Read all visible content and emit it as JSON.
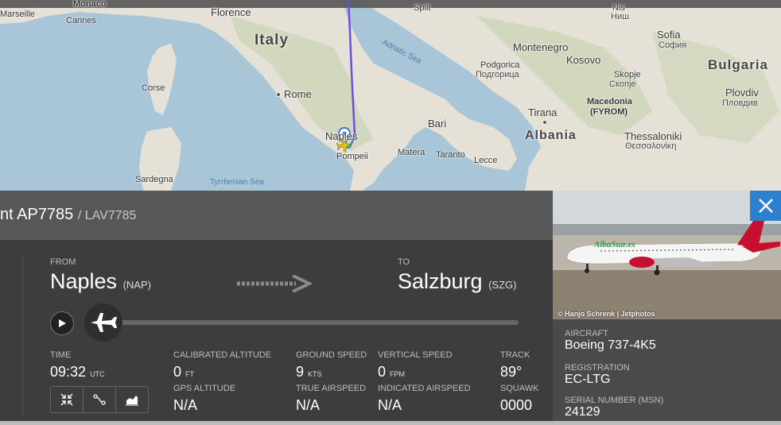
{
  "map": {
    "cities": {
      "marseille": "Marseille",
      "monaco": "Monaco",
      "cannes": "Cannes",
      "florence": "Florence",
      "split": "Split",
      "nis": "Nis",
      "nis_cyr": "Ниш",
      "sofia": "Sofia",
      "sofia_cyr": "София",
      "italy": "Italy",
      "montenegro": "Montenegro",
      "kosovo": "Kosovo",
      "bulgaria": "Bulgaria",
      "podgorica": "Podgorica",
      "podgorica_cyr": "Подгорица",
      "skopje": "Skopje",
      "skopje_cyr": "Скопје",
      "plovdiv": "Plovdiv",
      "plovdiv_cyr": "Пловдив",
      "corse": "Corse",
      "rome": "Rome",
      "tirana": "Tirana",
      "macedonia": "Macedonia",
      "fyrom": "(FYROM)",
      "bari": "Bari",
      "naples": "Naples",
      "albania": "Albania",
      "thessaloniki": "Thessaloniki",
      "thessaloniki_gr": "Θεσσαλονίκη",
      "pompeii": "Pompeii",
      "matera": "Matera",
      "taranto": "Taranto",
      "lecce": "Lecce",
      "sardegna": "Sardegna",
      "tyrrhenian": "Tyrrhenian Sea",
      "adriatic": "Adriatic Sea"
    }
  },
  "flight": {
    "number_partial": "nt AP7785",
    "callsign": "/ LAV7785"
  },
  "route": {
    "from_label": "FROM",
    "from_city": "Naples",
    "from_code": "(NAP)",
    "to_label": "TO",
    "to_city": "Salzburg",
    "to_code": "(SZG)"
  },
  "stats": {
    "time_label": "TIME",
    "time_value": "09:32",
    "time_unit": "UTC",
    "cal_alt_label": "CALIBRATED ALTITUDE",
    "cal_alt_value": "0",
    "cal_alt_unit": "FT",
    "gps_alt_label": "GPS ALTITUDE",
    "gps_alt_value": "N/A",
    "ground_speed_label": "GROUND SPEED",
    "ground_speed_value": "9",
    "ground_speed_unit": "KTS",
    "true_airspeed_label": "TRUE AIRSPEED",
    "true_airspeed_value": "N/A",
    "vertical_speed_label": "VERTICAL SPEED",
    "vertical_speed_value": "0",
    "vertical_speed_unit": "FPM",
    "indicated_airspeed_label": "INDICATED AIRSPEED",
    "indicated_airspeed_value": "N/A",
    "track_label": "TRACK",
    "track_value": "89°",
    "squawk_label": "SQUAWK",
    "squawk_value": "0000"
  },
  "photo": {
    "credit": "© Hanjo Schrenk | Jetphotos",
    "livery_text": "AlbaStar.es"
  },
  "aircraft": {
    "aircraft_label": "AIRCRAFT",
    "aircraft_value": "Boeing 737-4K5",
    "registration_label": "REGISTRATION",
    "registration_value": "EC-LTG",
    "serial_label": "SERIAL NUMBER (MSN)",
    "serial_value": "24129"
  },
  "colors": {
    "accent_blue": "#2f7fd1",
    "route_line": "#6a4fe0",
    "plane_marker": "#f2c500"
  }
}
